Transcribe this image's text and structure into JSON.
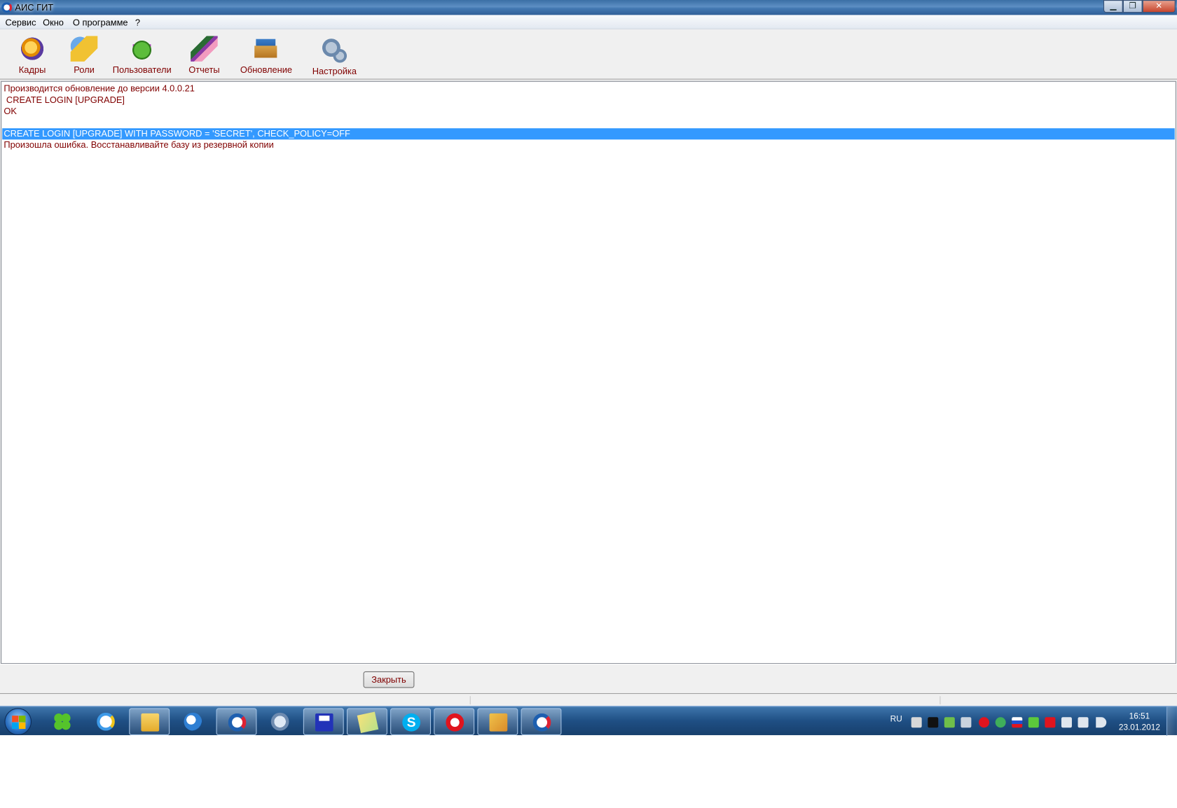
{
  "window": {
    "title": "АИС ГИТ"
  },
  "menu": {
    "items": [
      "Сервис",
      "Окно",
      "О программе",
      "?"
    ]
  },
  "toolbar": {
    "tools": [
      {
        "label": "Кадры",
        "icon": "kadry-icon"
      },
      {
        "label": "Роли",
        "icon": "roles-icon"
      },
      {
        "label": "Пользователи",
        "icon": "users-icon"
      },
      {
        "label": "Отчеты",
        "icon": "reports-icon"
      },
      {
        "label": "Обновление",
        "icon": "update-icon"
      },
      {
        "label": "Настройка",
        "icon": "settings-icon"
      }
    ]
  },
  "log": {
    "lines": [
      "Производится обновление до версии 4.0.0.21",
      " CREATE LOGIN [UPGRADE]",
      "OK",
      "",
      "CREATE LOGIN [UPGRADE] WITH PASSWORD = 'SECRET', CHECK_POLICY=OFF",
      "Произошла ошибка. Восстанавливайте базу из резервной копии"
    ],
    "selected_index": 4
  },
  "bottom": {
    "close_label": "Закрыть"
  },
  "taskbar": {
    "apps": [
      "clover-icon",
      "internet-explorer-icon",
      "file-explorer-icon",
      "browser-globe-icon",
      "ais-git-icon",
      "mail-icon",
      "floppy-disk-icon",
      "notes-icon",
      "skype-icon",
      "opera-icon",
      "maps-icon",
      "ais-git-active-icon"
    ],
    "tray": {
      "language": "RU",
      "time": "16:51",
      "date": "23.01.2012"
    }
  },
  "colors": {
    "log_text": "#800000",
    "selection": "#3399ff",
    "taskbar": "#1f4f84"
  }
}
